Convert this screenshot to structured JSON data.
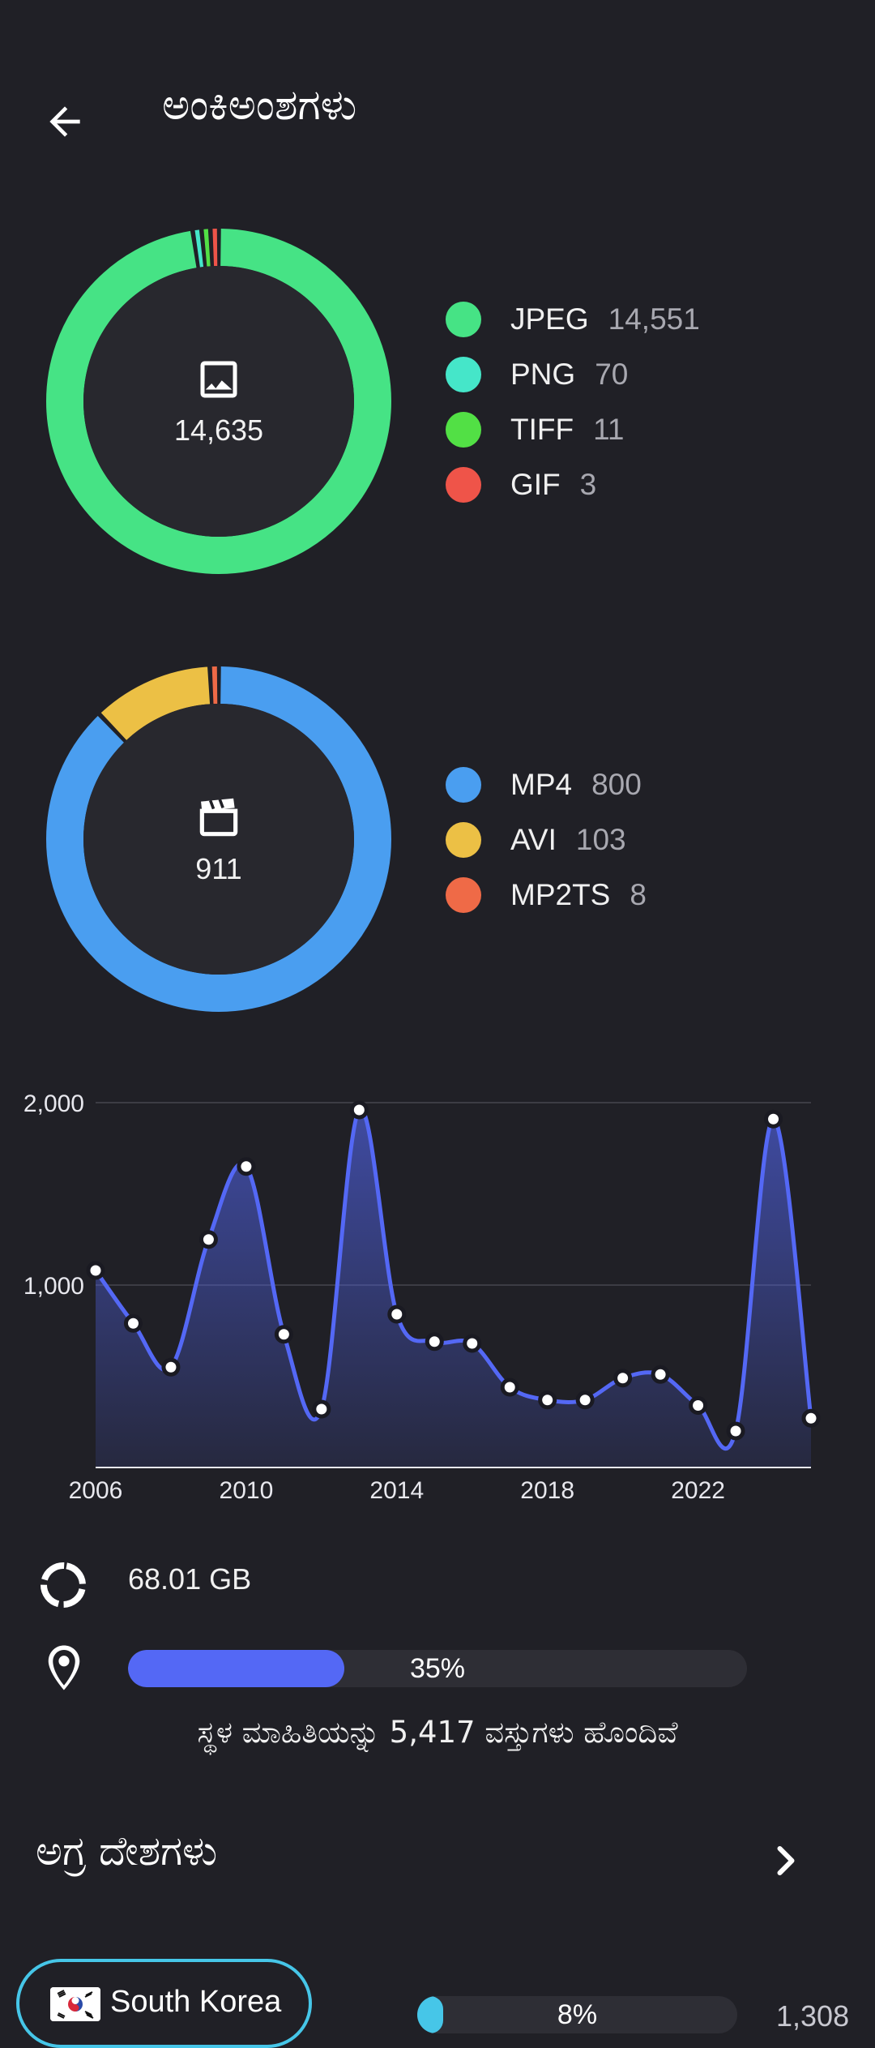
{
  "header": {
    "title": "ಅಂಕಿಅಂಶಗಳು",
    "back_icon": "arrow-left-icon"
  },
  "colors": {
    "background": "#202026",
    "card": "#28282e",
    "jpeg": "#46e385",
    "png": "#45e6c9",
    "tiff": "#52e045",
    "gif": "#ef5449",
    "mp4": "#4a9ef0",
    "avi": "#ecc045",
    "mp2ts": "#ef6a47",
    "accent": "#5468f5",
    "country": "#46c6e8"
  },
  "images": {
    "icon": "image-icon",
    "total": "14,635",
    "types": [
      {
        "label": "JPEG",
        "count": "14,551",
        "value": 14551,
        "color": "#46e385"
      },
      {
        "label": "PNG",
        "count": "70",
        "value": 70,
        "color": "#45e6c9"
      },
      {
        "label": "TIFF",
        "count": "11",
        "value": 11,
        "color": "#52e045"
      },
      {
        "label": "GIF",
        "count": "3",
        "value": 3,
        "color": "#ef5449"
      }
    ]
  },
  "videos": {
    "icon": "clapperboard-icon",
    "total": "911",
    "types": [
      {
        "label": "MP4",
        "count": "800",
        "value": 800,
        "color": "#4a9ef0"
      },
      {
        "label": "AVI",
        "count": "103",
        "value": 103,
        "color": "#ecc045"
      },
      {
        "label": "MP2TS",
        "count": "8",
        "value": 8,
        "color": "#ef6a47"
      }
    ]
  },
  "chart_data": {
    "type": "area",
    "x": [
      2006,
      2007,
      2008,
      2009,
      2010,
      2011,
      2012,
      2013,
      2014,
      2015,
      2016,
      2017,
      2018,
      2019,
      2020,
      2021,
      2022,
      2023,
      2024,
      2025
    ],
    "values": [
      1080,
      790,
      550,
      1250,
      1650,
      730,
      320,
      1960,
      840,
      690,
      680,
      440,
      370,
      370,
      490,
      510,
      340,
      200,
      1910,
      270
    ],
    "x_ticks": [
      "2006",
      "2010",
      "2014",
      "2018",
      "2022"
    ],
    "y_ticks": [
      "1,000",
      "2,000"
    ],
    "ylim": [
      0,
      2000
    ],
    "grid": true,
    "color": "#5468f5"
  },
  "storage": {
    "icon": "storage-pie-icon",
    "value": "68.01 GB"
  },
  "location": {
    "icon": "location-pin-icon",
    "percent": 35,
    "percent_label": "35%",
    "caption": "ಸ್ಥಳ ಮಾಹಿತಿಯನ್ನು 5,417 ವಸ್ತುಗಳು ಹೊಂದಿವೆ"
  },
  "top_countries": {
    "title": "ಅಗ್ರ ದೇಶಗಳು",
    "chevron_icon": "chevron-right-icon",
    "items": [
      {
        "name": "South Korea",
        "flag_icon": "south-korea-flag-icon",
        "percent": 8,
        "percent_label": "8%",
        "count": "1,308"
      }
    ]
  }
}
